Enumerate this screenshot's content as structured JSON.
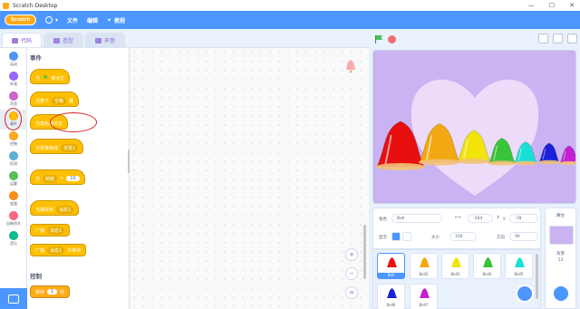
{
  "window": {
    "title": "Scratch Desktop",
    "controls": [
      "—",
      "☐",
      "✕"
    ]
  },
  "menubar": {
    "logo": "Scratch",
    "file": "文件",
    "edit": "编辑",
    "tutorials": "教程"
  },
  "tabs": [
    {
      "label": "代码",
      "icon": "code-icon"
    },
    {
      "label": "造型",
      "icon": "brush-icon"
    },
    {
      "label": "声音",
      "icon": "speaker-icon"
    }
  ],
  "categories": [
    {
      "label": "运动",
      "color": "#4c97ff"
    },
    {
      "label": "外观",
      "color": "#9966ff"
    },
    {
      "label": "声音",
      "color": "#cf63cf"
    },
    {
      "label": "事件",
      "color": "#ffbf00"
    },
    {
      "label": "控制",
      "color": "#ffab19"
    },
    {
      "label": "侦测",
      "color": "#5cb1d6"
    },
    {
      "label": "运算",
      "color": "#59c059"
    },
    {
      "label": "变量",
      "color": "#ff8c1a"
    },
    {
      "label": "自制积木",
      "color": "#ff6680"
    },
    {
      "label": "音乐",
      "color": "#0fbd8c"
    }
  ],
  "palette": {
    "events_title": "事件",
    "blocks": [
      {
        "text": "当  被点击",
        "icon": "green-flag-icon"
      },
      {
        "text": "当按下",
        "dropdown": "空格",
        "suffix": "键"
      },
      {
        "text": "当角色被点击"
      },
      {
        "text": "当背景换成",
        "dropdown": "背景1"
      },
      {
        "text": "当",
        "dropdown": "响度",
        "op": ">",
        "value": "10"
      },
      {
        "text": "当接收到",
        "dropdown": "消息1"
      },
      {
        "text": "广播",
        "dropdown": "消息1"
      },
      {
        "text": "广播",
        "dropdown": "消息1",
        "suffix": "并等待"
      }
    ],
    "control_title": "控制",
    "control_block": {
      "text": "等待",
      "value": "1",
      "suffix": "秒"
    }
  },
  "zoom": {
    "in": "+",
    "out": "−",
    "reset": "="
  },
  "stage": {
    "bell_colors": [
      "#e80f0f",
      "#f2a812",
      "#f2e40a",
      "#3ac43a",
      "#19e0d4",
      "#1b22d9",
      "#c41fd1"
    ]
  },
  "sprite_info": {
    "sprite_label": "角色",
    "sprite_name": "Bell",
    "x_label": "x",
    "x_value": "-164",
    "y_label": "y",
    "y_value": "-78",
    "show_label": "显示",
    "size_label": "大小",
    "size_value": "100",
    "direction_label": "方向",
    "direction_value": "90"
  },
  "sprites": [
    "Bell",
    "Bell2",
    "Bell3",
    "Bell4",
    "Bell5",
    "Bell6",
    "Bell7"
  ],
  "stage_panel": {
    "title": "舞台",
    "backdrop_label": "背景",
    "backdrop_count": "13"
  }
}
